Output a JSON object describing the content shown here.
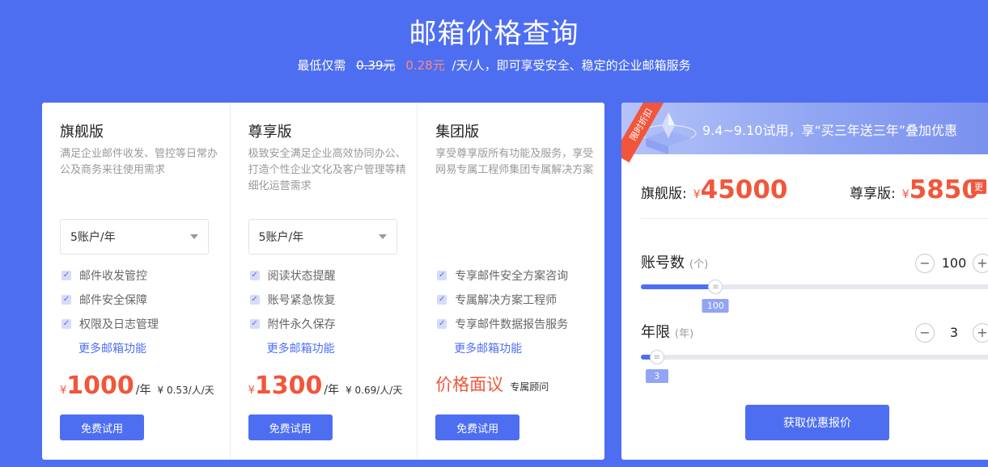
{
  "hero": {
    "title": "邮箱价格查询",
    "sub_prefix": "最低仅需",
    "old_price": "0.39元",
    "new_price": "0.28元",
    "sub_suffix": "/天/人，即可享受安全、稳定的企业邮箱服务"
  },
  "plans": [
    {
      "name": "旗舰版",
      "desc": "满足企业邮件收发、管控等日常办公及商务来往使用需求",
      "select": "5账户/年",
      "features": [
        "邮件收发管控",
        "邮件安全保障",
        "权限及日志管理"
      ],
      "more": "更多邮箱功能",
      "currency": "¥",
      "amount": "1000",
      "unit": "/年",
      "per_day": "¥ 0.53/人/天",
      "button": "免费试用"
    },
    {
      "name": "尊享版",
      "desc": "极致安全满足企业高效协同办公、打造个性企业文化及客户管理等精细化运营需求",
      "select": "5账户/年",
      "features": [
        "阅读状态提醒",
        "账号紧急恢复",
        "附件永久保存"
      ],
      "more": "更多邮箱功能",
      "currency": "¥",
      "amount": "1300",
      "unit": "/年",
      "per_day": "¥ 0.69/人/天",
      "button": "免费试用"
    },
    {
      "name": "集团版",
      "desc": "享受尊享版所有功能及服务，享受网易专属工程师集团专属解决方案",
      "features": [
        "专享邮件安全方案咨询",
        "专属解决方案工程师",
        "专享邮件数据报告服务"
      ],
      "more": "更多邮箱功能",
      "face_price": "价格面议",
      "consultant": "专属顾问",
      "button": "免费试用"
    }
  ],
  "promo": {
    "ribbon": "限时折扣",
    "banner_text": "9.4~9.10试用，享“买三年送三年”叠加优惠",
    "flagship_label": "旗舰版:",
    "flagship_currency": "¥",
    "flagship_amount": "45000",
    "premium_label": "尊享版:",
    "premium_currency": "¥",
    "premium_amount": "5850",
    "more_tag": "更",
    "accounts_label": "账号数",
    "accounts_unit": "(个)",
    "accounts_value": "100",
    "accounts_tip": "100",
    "accounts_level": 0.21,
    "years_label": "年限",
    "years_unit": "(年)",
    "years_value": "3",
    "years_tip": "3",
    "years_level": 0.045,
    "minus": "−",
    "plus": "+",
    "quote_button": "获取优惠报价"
  },
  "colors": {
    "brand": "#4e6ef2",
    "accent": "#f1563b"
  }
}
